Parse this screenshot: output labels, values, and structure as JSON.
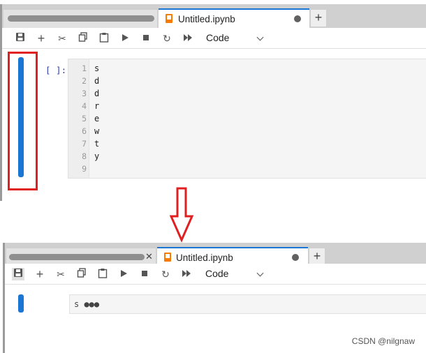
{
  "panel_before": {
    "tabs": [
      {
        "label": "Untitled.ipynb",
        "active": true
      }
    ],
    "toolbar": {
      "icons": [
        "save-icon",
        "add-icon",
        "cut-icon",
        "copy-icon",
        "paste-icon",
        "run-icon",
        "stop-icon",
        "restart-icon",
        "fast-forward-icon"
      ],
      "cell_type": "Code"
    },
    "cell": {
      "prompt": "[ ]:",
      "line_numbers": [
        "1",
        "2",
        "3",
        "4",
        "5",
        "6",
        "7",
        "8",
        "9"
      ],
      "lines": [
        "s",
        "d",
        "d",
        "r",
        "e",
        "w",
        "t",
        "y",
        ""
      ]
    }
  },
  "panel_after": {
    "tabs": [
      {
        "label": "Untitled.ipynb",
        "active": true
      }
    ],
    "toolbar": {
      "cell_type": "Code"
    },
    "cell": {
      "collapsed_text": "s ●●●"
    }
  },
  "watermark": "CSDN @nilgnaw",
  "colors": {
    "accent": "#1976d2",
    "highlight": "#e02020",
    "tab_icon": "#f57c00"
  }
}
